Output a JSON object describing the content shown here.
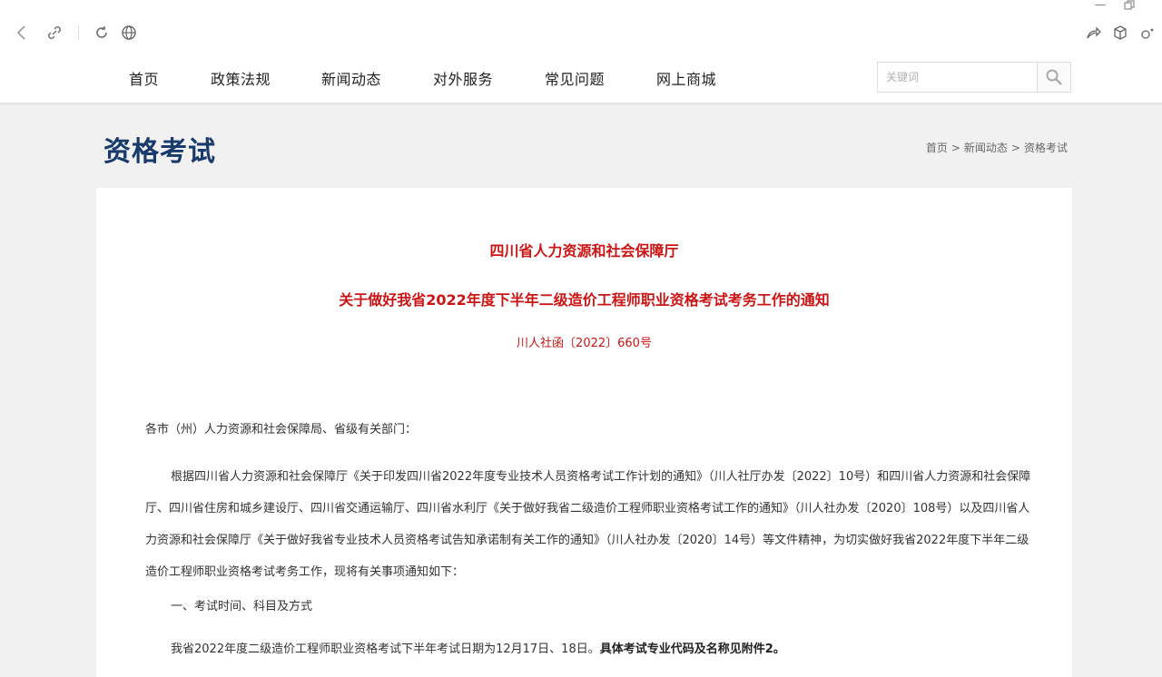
{
  "nav": {
    "items": [
      "首页",
      "政策法规",
      "新闻动态",
      "对外服务",
      "常见问题",
      "网上商城"
    ]
  },
  "search": {
    "placeholder": "关键词"
  },
  "page": {
    "title": "资格考试"
  },
  "breadcrumb": {
    "home": "首页",
    "sep1": ">",
    "news": "新闻动态",
    "sep2": ">",
    "current": "资格考试"
  },
  "article": {
    "issuer": "四川省人力资源和社会保障厅",
    "title": "关于做好我省2022年度下半年二级造价工程师职业资格考试考务工作的通知",
    "doc_number": "川人社函〔2022〕660号",
    "salutation": "各市（州）人力资源和社会保障局、省级有关部门：",
    "paragraph1": "根据四川省人力资源和社会保障厅《关于印发四川省2022年度专业技术人员资格考试工作计划的通知》（川人社厅办发〔2022〕10号）和四川省人力资源和社会保障厅、四川省住房和城乡建设厅、四川省交通运输厅、四川省水利厅《关于做好我省二级造价工程师职业资格考试工作的通知》（川人社办发〔2020〕108号）以及四川省人力资源和社会保障厅《关于做好我省专业技术人员资格考试告知承诺制有关工作的通知》（川人社办发〔2020〕14号）等文件精神，为切实做好我省2022年度下半年二级造价工程师职业资格考试考务工作，现将有关事项通知如下：",
    "section1": "一、考试时间、科目及方式",
    "paragraph2_normal": "我省2022年度二级造价工程师职业资格考试下半年考试日期为12月17日、18日。",
    "paragraph2_bold": "具体考试专业代码及名称见附件2。"
  },
  "colors": {
    "accent_red": "#cc1414",
    "title_blue": "#183b6b"
  },
  "icons": [
    "back-icon",
    "link-icon",
    "reload-icon",
    "globe-icon",
    "share-icon",
    "cube-icon",
    "settings-icon",
    "search-icon"
  ]
}
